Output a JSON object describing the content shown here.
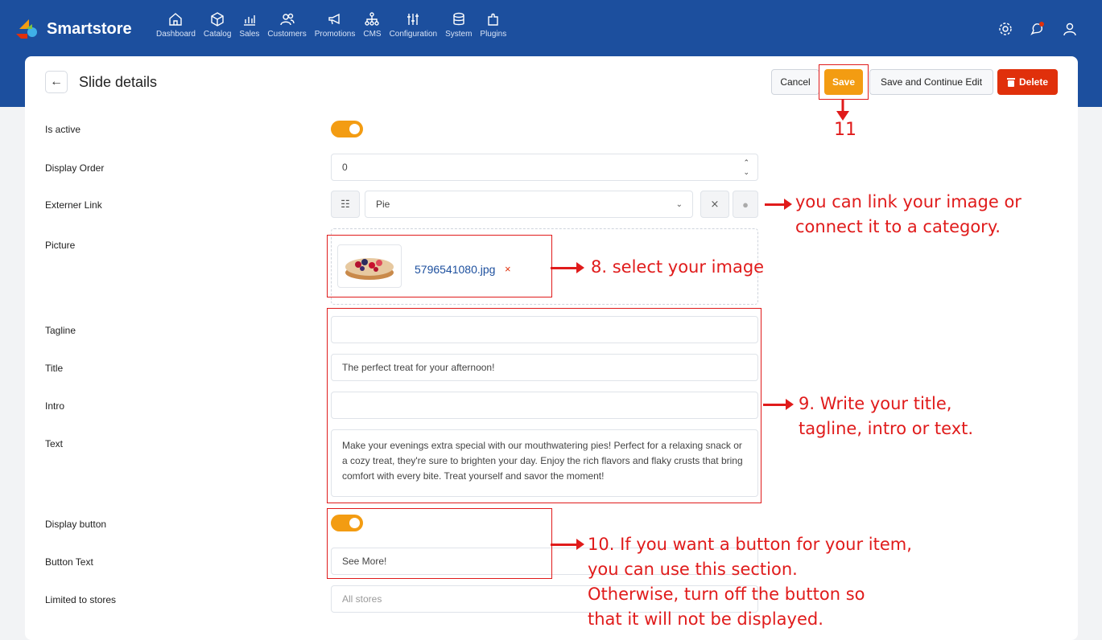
{
  "app": {
    "brand": "Smartstore",
    "nav": [
      {
        "label": "Dashboard",
        "icon": "home-icon"
      },
      {
        "label": "Catalog",
        "icon": "cube-icon"
      },
      {
        "label": "Sales",
        "icon": "chart-icon"
      },
      {
        "label": "Customers",
        "icon": "users-icon"
      },
      {
        "label": "Promotions",
        "icon": "megaphone-icon"
      },
      {
        "label": "CMS",
        "icon": "sitemap-icon"
      },
      {
        "label": "Configuration",
        "icon": "sliders-icon"
      },
      {
        "label": "System",
        "icon": "database-icon"
      },
      {
        "label": "Plugins",
        "icon": "puzzle-icon"
      }
    ]
  },
  "page": {
    "title": "Slide details",
    "buttons": {
      "cancel": "Cancel",
      "save": "Save",
      "save_continue": "Save and Continue Edit",
      "delete": "Delete"
    }
  },
  "form": {
    "is_active": {
      "label": "Is active",
      "value": true
    },
    "display_order": {
      "label": "Display Order",
      "value": "0"
    },
    "external_link": {
      "label": "Externer Link",
      "value": "Pie"
    },
    "picture": {
      "label": "Picture",
      "file_name": "5796541080.jpg",
      "remove": "×"
    },
    "tagline": {
      "label": "Tagline",
      "value": ""
    },
    "title": {
      "label": "Title",
      "value": "The perfect treat for your afternoon!"
    },
    "intro": {
      "label": "Intro",
      "value": ""
    },
    "text": {
      "label": "Text",
      "value": "Make your evenings extra special with our mouthwatering pies! Perfect for a relaxing snack or a cozy treat, they're sure to brighten your day. Enjoy the rich flavors and flaky crusts that bring comfort with every bite. Treat yourself and savor the moment!"
    },
    "display_button": {
      "label": "Display button",
      "value": true
    },
    "button_text": {
      "label": "Button Text",
      "value": "See More!"
    },
    "limited_to_stores": {
      "label": "Limited to stores",
      "placeholder": "All stores"
    }
  },
  "annotations": {
    "save_step": "11",
    "link_note": "you can link your image or\nconnect it to a category.",
    "image_note": "8. select your image",
    "text_note": "9. Write your title,\ntagline, intro or text.",
    "button_note": "10. If you want a button for your item,\nyou can use this section.\nOtherwise, turn off the button so\nthat it will not be displayed."
  },
  "colors": {
    "header": "#1c4f9e",
    "accent": "#f39c12",
    "danger": "#e0300b",
    "annotation": "#e01b1b"
  }
}
